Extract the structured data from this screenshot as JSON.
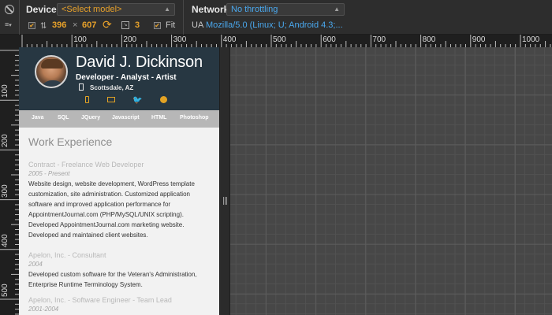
{
  "toolbar": {
    "device_label": "Device",
    "device_select": "<Select model>",
    "network_label": "Network",
    "network_select": "No throttling",
    "width": "396",
    "times": "×",
    "height": "607",
    "scale": "3",
    "fit_label": "Fit",
    "ua_label": "UA",
    "ua_value": "Mozilla/5.0 (Linux; U; Android 4.3;..."
  },
  "rulers": {
    "horizontal": [
      "100",
      "200",
      "300",
      "400",
      "500",
      "600",
      "700",
      "800",
      "900",
      "1000"
    ],
    "vertical": [
      "100",
      "200",
      "300",
      "400",
      "500"
    ]
  },
  "profile": {
    "name": "David J. Dickinson",
    "role": "Developer - Analyst - Artist",
    "location": "Scottsdale, AZ",
    "social_icons": [
      "mobile-icon",
      "mail-icon",
      "twitter-icon",
      "github-icon"
    ]
  },
  "tabs": [
    "Java",
    "SQL",
    "JQuery",
    "Javascript",
    "HTML",
    "Photoshop"
  ],
  "experience": {
    "heading": "Work Experience",
    "jobs": [
      {
        "title": "Contract - Freelance Web Developer",
        "date": "2005 - Present",
        "desc": "Website design, website development, WordPress template customization, site administration. Customized application software and improved application performance for AppointmentJournal.com (PHP/MySQL/UNIX scripting). Developed AppointmentJournal.com marketing website. Developed and maintained client websites."
      },
      {
        "title": "Apelon, Inc. - Consultant",
        "date": "2004",
        "desc": "Developed custom software for the Veteran's Administration, Enterprise Runtime Terminology System."
      },
      {
        "title": "Apelon, Inc. - Software Engineer - Team Lead",
        "date": "2001-2004",
        "desc": ""
      }
    ]
  },
  "colors": {
    "accent_orange": "#e7a12a",
    "accent_blue": "#4aa8ee",
    "header_bg": "#273742"
  }
}
